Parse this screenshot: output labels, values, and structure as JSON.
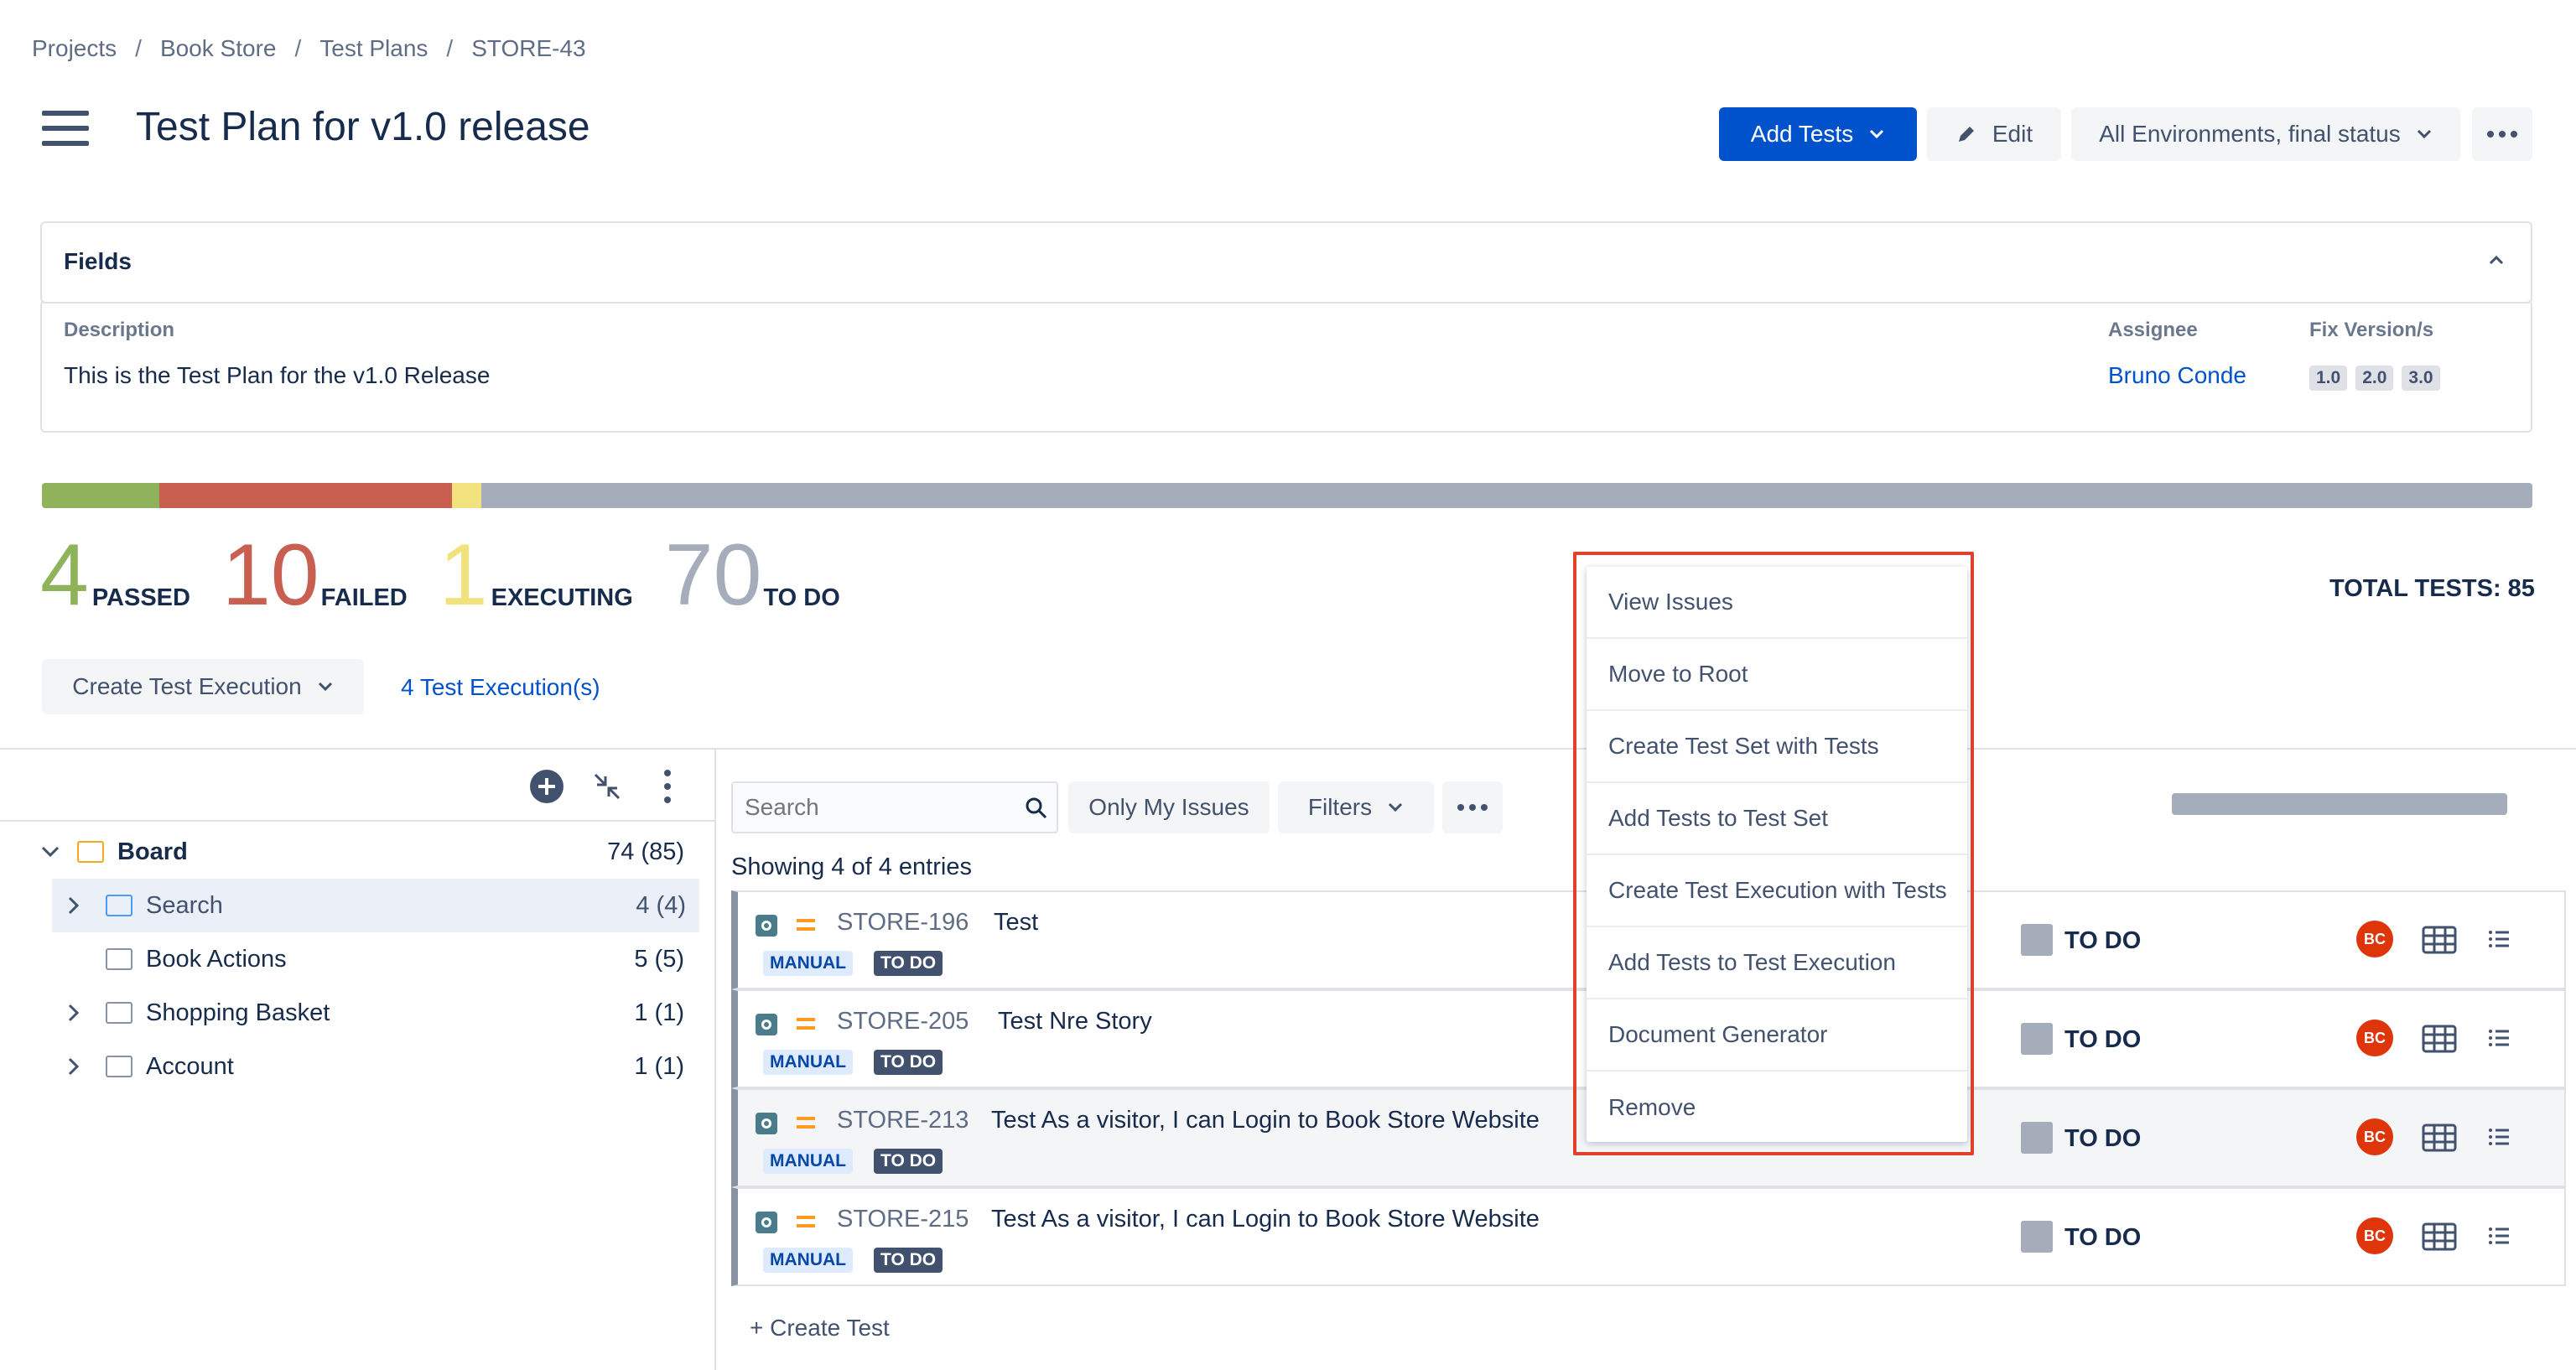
{
  "breadcrumb": [
    "Projects",
    "Book Store",
    "Test Plans",
    "STORE-43"
  ],
  "title": "Test Plan for v1.0 release",
  "header": {
    "add_tests": "Add Tests",
    "edit": "Edit",
    "env_select": "All Environments, final status"
  },
  "fields": {
    "heading": "Fields",
    "description_label": "Description",
    "description": "This is the Test Plan for the v1.0 Release",
    "assignee_label": "Assignee",
    "assignee": "Bruno Conde",
    "fixversion_label": "Fix Version/s",
    "versions": [
      "1.0",
      "2.0",
      "3.0"
    ]
  },
  "progress": {
    "passed": 4,
    "failed": 10,
    "executing": 1,
    "todo": 70,
    "total": 85,
    "colors": {
      "passed": "#8eb35a",
      "failed": "#c95f50",
      "executing": "#f2e27d",
      "todo": "#a5adba"
    }
  },
  "stats": {
    "passed_label": "PASSED",
    "failed_label": "FAILED",
    "executing_label": "EXECUTING",
    "todo_label": "TO DO",
    "passed": "4",
    "failed": "10",
    "executing": "1",
    "todo": "70",
    "total_text": "TOTAL TESTS: 85"
  },
  "actions": {
    "create_exec": "Create Test Execution",
    "exec_link": "4 Test Execution(s)"
  },
  "tree": {
    "root": {
      "label": "Board",
      "count": "74 (85)"
    },
    "items": [
      {
        "label": "Search",
        "count": "4 (4)"
      },
      {
        "label": "Book Actions",
        "count": "5 (5)"
      },
      {
        "label": "Shopping Basket",
        "count": "1 (1)"
      },
      {
        "label": "Account",
        "count": "1 (1)"
      }
    ]
  },
  "toolbar": {
    "search_placeholder": "Search",
    "only_mine": "Only My Issues",
    "filters": "Filters"
  },
  "entries_text": "Showing 4 of 4 entries",
  "tests": [
    {
      "key": "STORE-196",
      "summary": "Test",
      "type": "MANUAL",
      "status": "TO DO",
      "run_status": "TO DO",
      "avatar": "BC"
    },
    {
      "key": "STORE-205",
      "summary": "Test Nre Story",
      "type": "MANUAL",
      "status": "TO DO",
      "run_status": "TO DO",
      "avatar": "BC"
    },
    {
      "key": "STORE-213",
      "summary": "Test As a visitor, I can Login to Book Store Website",
      "type": "MANUAL",
      "status": "TO DO",
      "run_status": "TO DO",
      "avatar": "BC"
    },
    {
      "key": "STORE-215",
      "summary": "Test As a visitor, I can Login to Book Store Website",
      "type": "MANUAL",
      "status": "TO DO",
      "run_status": "TO DO",
      "avatar": "BC"
    }
  ],
  "create_test": "+ Create Test",
  "menu": [
    "View Issues",
    "Move to Root",
    "Create Test Set with Tests",
    "Add Tests to Test Set",
    "Create Test Execution with Tests",
    "Add Tests to Test Execution",
    "Document Generator",
    "Remove"
  ]
}
